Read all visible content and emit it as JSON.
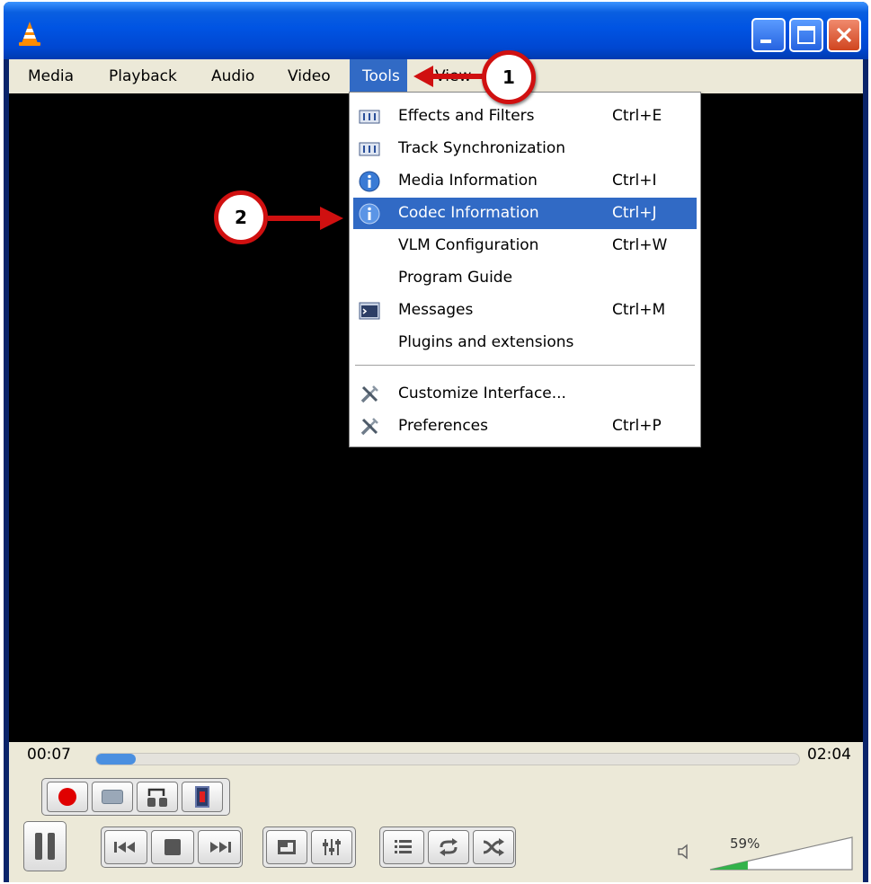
{
  "window": {
    "title_bar_buttons": [
      "minimize",
      "maximize",
      "close"
    ],
    "colors": {
      "title_bar": "#0054e3",
      "menu_highlight": "#316ac5",
      "annotation": "#d01010"
    }
  },
  "menubar": {
    "items": [
      {
        "label": "Media"
      },
      {
        "label": "Playback"
      },
      {
        "label": "Audio"
      },
      {
        "label": "Video"
      },
      {
        "label": "Tools"
      },
      {
        "label": "View"
      }
    ]
  },
  "tools_menu": {
    "items": [
      {
        "label": "Effects and Filters",
        "shortcut": "Ctrl+E",
        "icon": "equalizer-icon"
      },
      {
        "label": "Track Synchronization",
        "shortcut": "",
        "icon": "equalizer-icon"
      },
      {
        "label": "Media Information",
        "shortcut": "Ctrl+I",
        "icon": "info-icon"
      },
      {
        "label": "Codec Information",
        "shortcut": "Ctrl+J",
        "icon": "info-icon",
        "highlighted": true
      },
      {
        "label": "VLM Configuration",
        "shortcut": "Ctrl+W",
        "icon": ""
      },
      {
        "label": "Program Guide",
        "shortcut": "",
        "icon": ""
      },
      {
        "label": "Messages",
        "shortcut": "Ctrl+M",
        "icon": "terminal-icon"
      },
      {
        "label": "Plugins and extensions",
        "shortcut": "",
        "icon": ""
      },
      {
        "label": "Customize Interface...",
        "shortcut": "",
        "icon": "tools-icon"
      },
      {
        "label": "Preferences",
        "shortcut": "Ctrl+P",
        "icon": "tools-icon"
      }
    ]
  },
  "annotations": {
    "step1": "1",
    "step2": "2"
  },
  "player": {
    "elapsed": "00:07",
    "duration": "02:04",
    "progress_fraction": 0.056,
    "volume_label": "59%",
    "volume_fraction": 0.59
  }
}
